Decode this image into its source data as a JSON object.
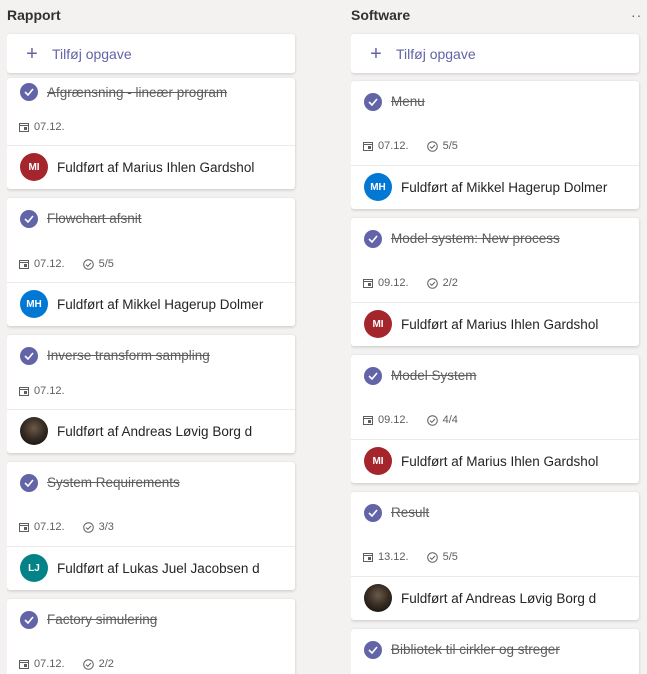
{
  "columns": [
    {
      "title": "Rapport",
      "add_label": "Tilføj opgave",
      "cards": [
        {
          "title": "Afgrænsning - lineær program",
          "date": "07.12.",
          "checklist": "",
          "assignee": "Fuldført af Marius Ihlen Gardshol",
          "initials": "MI",
          "avatar_color": "#a4262c"
        },
        {
          "title": "Flowchart afsnit",
          "date": "07.12.",
          "checklist": "5/5",
          "assignee": "Fuldført af Mikkel Hagerup Dolmer",
          "initials": "MH",
          "avatar_color": "#0078d4"
        },
        {
          "title": "Inverse transform sampling",
          "date": "07.12.",
          "checklist": "",
          "assignee": "Fuldført af Andreas Løvig Borg d",
          "initials": "",
          "avatar_color": "photo"
        },
        {
          "title": "System Requirements",
          "date": "07.12.",
          "checklist": "3/3",
          "assignee": "Fuldført af Lukas Juel Jacobsen d",
          "initials": "LJ",
          "avatar_color": "#038387"
        },
        {
          "title": "Factory simulering",
          "date": "07.12.",
          "checklist": "2/2",
          "assignee": "",
          "initials": "",
          "avatar_color": ""
        }
      ]
    },
    {
      "title": "Software",
      "more_label": "···",
      "add_label": "Tilføj opgave",
      "cards": [
        {
          "title": "Menu",
          "date": "07.12.",
          "checklist": "5/5",
          "assignee": "Fuldført af Mikkel Hagerup Dolmer",
          "initials": "MH",
          "avatar_color": "#0078d4"
        },
        {
          "title": "Model system: New process",
          "date": "09.12.",
          "checklist": "2/2",
          "assignee": "Fuldført af Marius Ihlen Gardshol",
          "initials": "MI",
          "avatar_color": "#a4262c"
        },
        {
          "title": "Model System",
          "date": "09.12.",
          "checklist": "4/4",
          "assignee": "Fuldført af Marius Ihlen Gardshol",
          "initials": "MI",
          "avatar_color": "#a4262c"
        },
        {
          "title": "Result",
          "date": "13.12.",
          "checklist": "5/5",
          "assignee": "Fuldført af Andreas Løvig Borg d",
          "initials": "",
          "avatar_color": "photo"
        },
        {
          "title": "Bibliotek til cirkler og streger",
          "date": "",
          "checklist": "",
          "assignee": "",
          "initials": "",
          "avatar_color": ""
        }
      ]
    }
  ],
  "colors": {
    "accent": "#6264a7",
    "background": "#f3f2f1",
    "card": "#ffffff"
  }
}
